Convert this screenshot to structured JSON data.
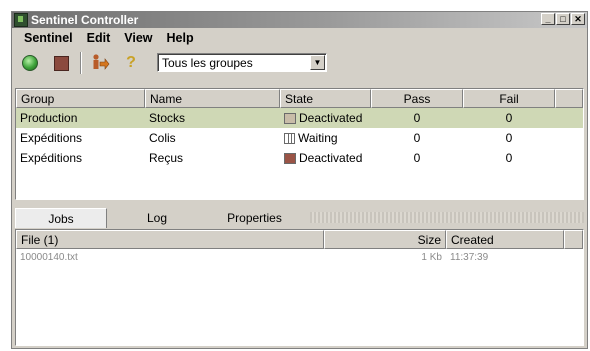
{
  "window": {
    "title": "Sentinel Controller",
    "buttons": [
      "_",
      "□",
      "✕"
    ]
  },
  "menu": [
    "Sentinel",
    "Edit",
    "View",
    "Help"
  ],
  "toolbar": {
    "icons": [
      "start-icon",
      "stop-icon",
      "person-arrow-icon",
      "help-icon"
    ],
    "group_filter": {
      "selected": "Tous les groupes"
    }
  },
  "groups_table": {
    "columns": [
      "Group",
      "Name",
      "State",
      "Pass",
      "Fail"
    ],
    "rows": [
      {
        "group": "Production",
        "name": "Stocks",
        "state": "Deactivated",
        "pass": "0",
        "fail": "0",
        "selected": true
      },
      {
        "group": "Expéditions",
        "name": "Colis",
        "state": "Waiting",
        "pass": "0",
        "fail": "0",
        "selected": false
      },
      {
        "group": "Expéditions",
        "name": "Reçus",
        "state": "Deactivated",
        "pass": "0",
        "fail": "0",
        "selected": false
      }
    ]
  },
  "tabs": [
    "Jobs",
    "Log",
    "Properties"
  ],
  "files_table": {
    "columns": [
      "File (1)",
      "Size",
      "Created"
    ],
    "rows": [
      {
        "file": "10000140.txt",
        "size": "1 Kb",
        "created": "11:37:39"
      }
    ]
  },
  "colors": {
    "selected_row": "#cfd8b5",
    "window_bg": "#d4d0c8",
    "deactivated_1": "#c8bca8",
    "deactivated_2": "#9a5446"
  }
}
